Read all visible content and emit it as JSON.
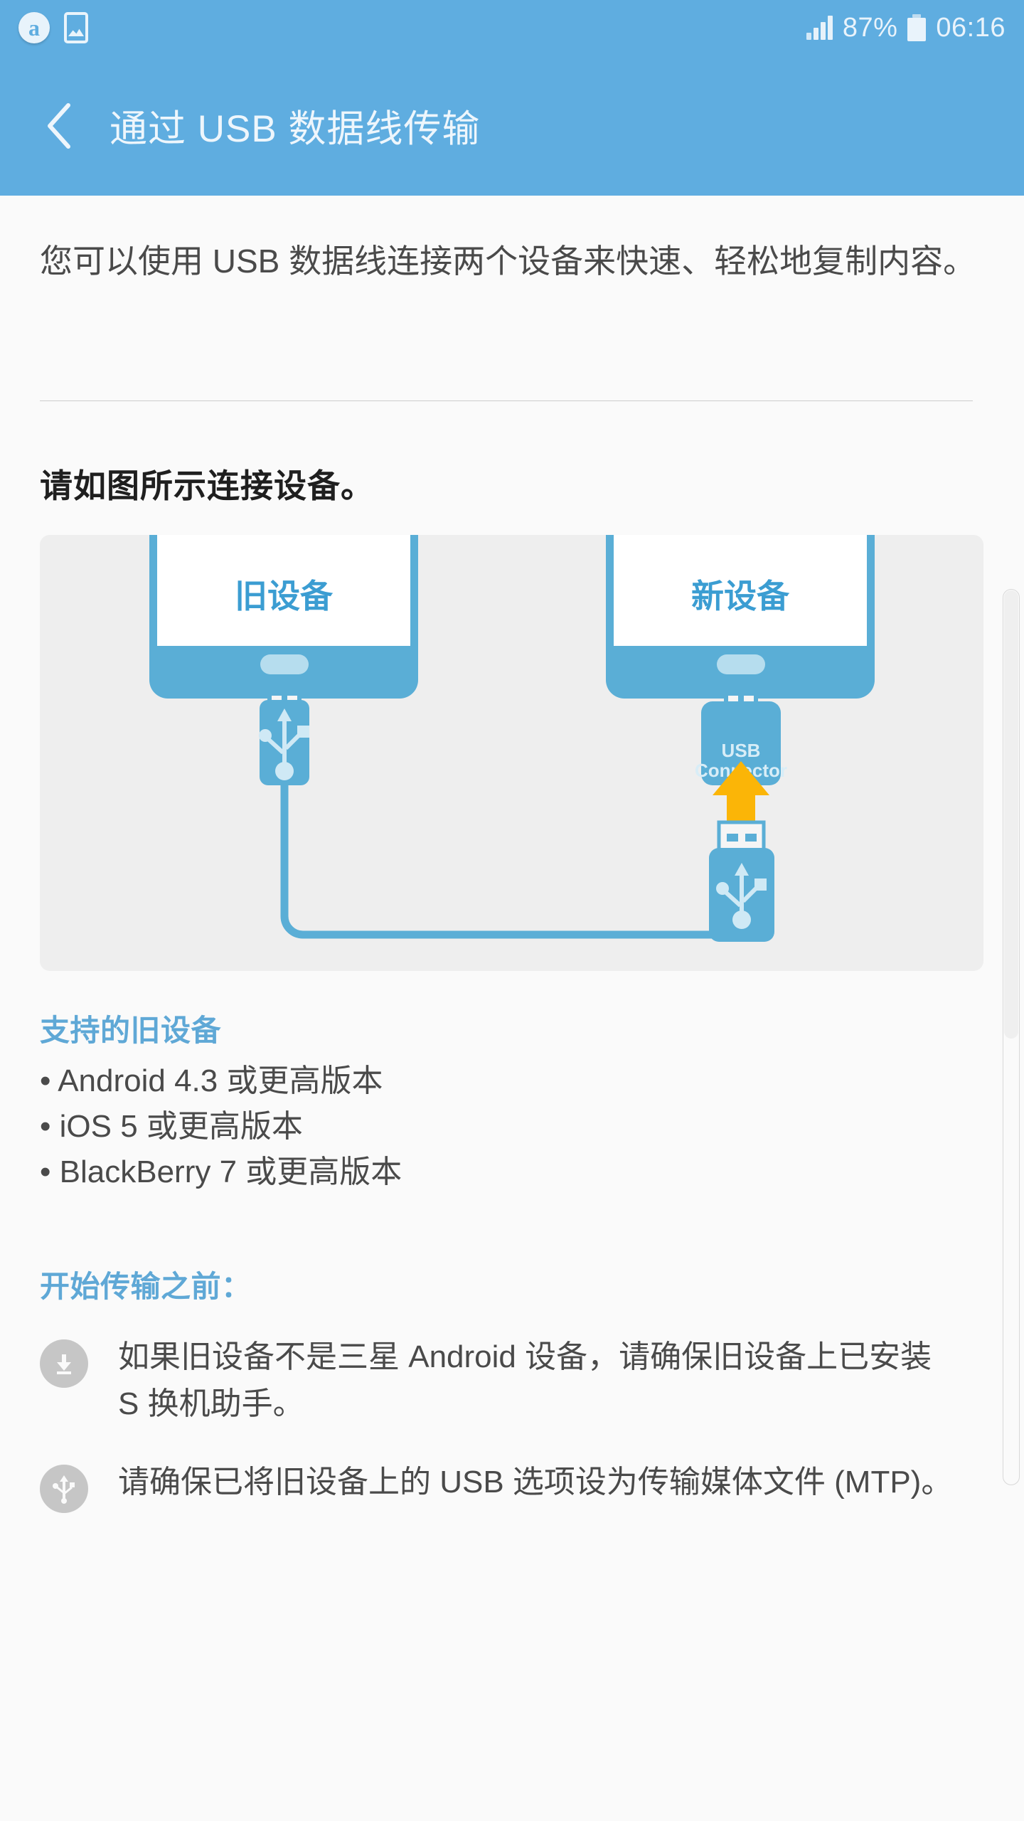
{
  "statusbar": {
    "app_badge_label": "a",
    "screenshot_icon": "image-icon",
    "signal_icon": "signal-bars-icon",
    "battery_percent": "87%",
    "battery_icon": "battery-icon",
    "time": "06:16"
  },
  "appbar": {
    "back_icon": "back-chevron-icon",
    "title": "通过 USB 数据线传输",
    "background_color": "#5fade0"
  },
  "body": {
    "intro": "您可以使用 USB 数据线连接两个设备来快速、轻松地复制内容。",
    "section_heading": "请如图所示连接设备。"
  },
  "illustration": {
    "old_device_label": "旧设备",
    "new_device_label": "新设备",
    "connector_label_line1": "USB",
    "connector_label_line2": "Connector",
    "device_color": "#5aaed6",
    "arrow_color": "#fbb507",
    "card_background": "#eeeeee"
  },
  "supported": {
    "heading": "支持的旧设备",
    "items": [
      "• Android 4.3 或更高版本",
      "• iOS 5 或更高版本",
      "• BlackBerry 7 或更高版本"
    ]
  },
  "before_transfer": {
    "heading": "开始传输之前：",
    "notes": [
      {
        "icon": "download-icon",
        "text": "如果旧设备不是三星 Android 设备，请确保旧设备上已安装 S 换机助手。"
      },
      {
        "icon": "usb-icon",
        "text": "请确保已将旧设备上的 USB 选项设为传输媒体文件 (MTP)。"
      }
    ]
  },
  "colors": {
    "accent": "#5fade0",
    "heading_blue": "#5fa8d6",
    "body_text": "#4a4a4a",
    "page_background": "#fafafa"
  }
}
